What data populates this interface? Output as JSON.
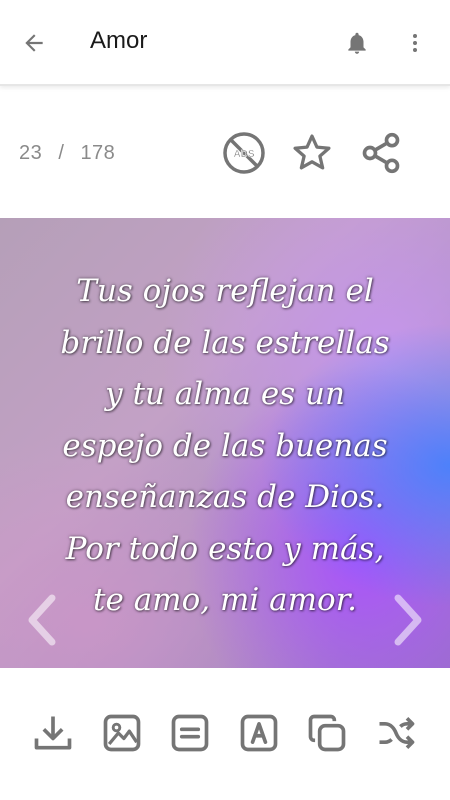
{
  "appbar": {
    "title": "Amor",
    "icons": [
      "arrow-back-icon",
      "bell-icon",
      "more-vert-icon"
    ]
  },
  "counter": {
    "current": "23",
    "separator": "/",
    "total": "178"
  },
  "actions": {
    "ads_label": "ADS",
    "icons": [
      "no-ads-icon",
      "star-icon",
      "share-icon"
    ]
  },
  "quote": {
    "text": "Tus ojos reflejan el\nbrillo de las estrellas\ny tu alma es un\nespejo de las buenas\nenseñanzas de Dios.\nPor todo esto y más,\nte amo, mi amor."
  },
  "toolbar": {
    "icons": [
      "download-icon",
      "image-icon",
      "text-block-icon",
      "font-icon",
      "copy-icon",
      "shuffle-icon"
    ]
  },
  "colors": {
    "icon": "#757575",
    "text": "#1a1a1a",
    "counter": "#8a8a8a",
    "quote_text": "#ffffff"
  }
}
